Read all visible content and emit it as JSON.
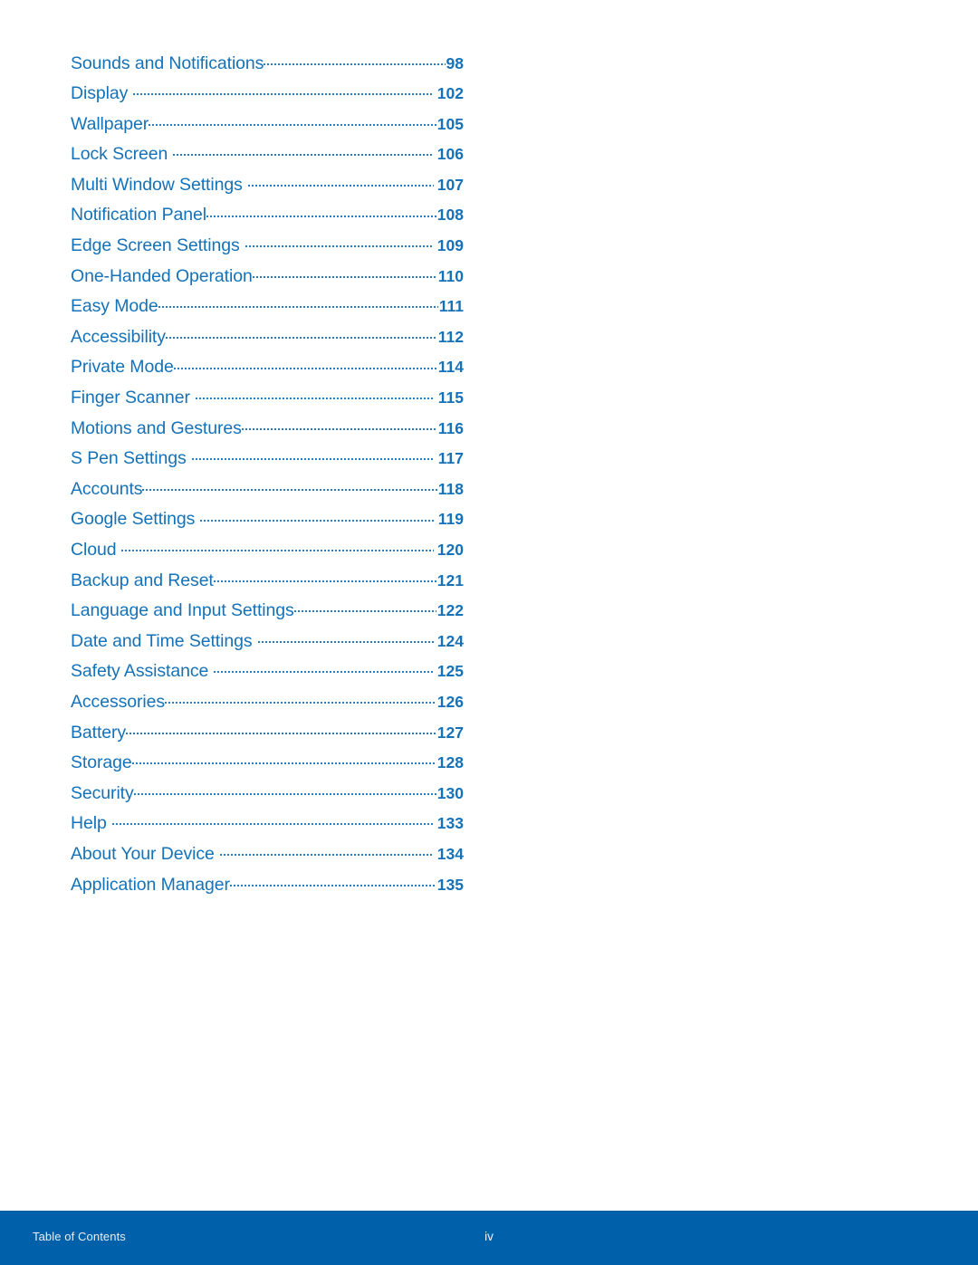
{
  "document": {
    "type": "table-of-contents",
    "colors": {
      "entry_text": "#1572B8",
      "page_number": "#1572B8",
      "footer_bar": "#0060A9",
      "footer_text": "#E8EEF4",
      "page_background": "#FFFFFF"
    }
  },
  "toc": {
    "entries": [
      {
        "title": "Sounds and Notifications",
        "page": "98",
        "leader": "tight"
      },
      {
        "title": "Display",
        "page": "102",
        "leader": "gapped"
      },
      {
        "title": "Wallpaper",
        "page": "105",
        "leader": "tight"
      },
      {
        "title": "Lock Screen",
        "page": "106",
        "leader": "gapped"
      },
      {
        "title": "Multi Window Settings",
        "page": "107",
        "leader": "gapped"
      },
      {
        "title": "Notification Panel",
        "page": "108",
        "leader": "tight"
      },
      {
        "title": "Edge Screen Settings",
        "page": "109",
        "leader": "gapped"
      },
      {
        "title": "One-Handed Operation",
        "page": "110",
        "leader": "tight"
      },
      {
        "title": "Easy Mode",
        "page": "111",
        "leader": "tight"
      },
      {
        "title": "Accessibility",
        "page": "112",
        "leader": "tight"
      },
      {
        "title": "Private Mode",
        "page": "114",
        "leader": "tight"
      },
      {
        "title": "Finger Scanner",
        "page": "115",
        "leader": "gapped"
      },
      {
        "title": "Motions and Gestures",
        "page": "116",
        "leader": "tight"
      },
      {
        "title": "S Pen Settings",
        "page": "117",
        "leader": "gapped"
      },
      {
        "title": "Accounts",
        "page": "118",
        "leader": "tight"
      },
      {
        "title": "Google Settings",
        "page": "119",
        "leader": "gapped"
      },
      {
        "title": "Cloud",
        "page": "120",
        "leader": "gapped"
      },
      {
        "title": "Backup and Reset",
        "page": "121",
        "leader": "tight"
      },
      {
        "title": "Language and Input Settings",
        "page": "122",
        "leader": "tight"
      },
      {
        "title": "Date and Time Settings",
        "page": "124",
        "leader": "gapped"
      },
      {
        "title": "Safety Assistance",
        "page": "125",
        "leader": "gapped"
      },
      {
        "title": "Accessories",
        "page": "126",
        "leader": "tight"
      },
      {
        "title": "Battery",
        "page": "127",
        "leader": "tight"
      },
      {
        "title": "Storage",
        "page": "128",
        "leader": "tight"
      },
      {
        "title": "Security",
        "page": "130",
        "leader": "tight"
      },
      {
        "title": "Help",
        "page": "133",
        "leader": "gapped"
      },
      {
        "title": "About Your Device",
        "page": "134",
        "leader": "gapped"
      },
      {
        "title": "Application Manager",
        "page": "135",
        "leader": "tight"
      }
    ]
  },
  "footer": {
    "section_label": "Table of Contents",
    "page_number": "iv"
  }
}
